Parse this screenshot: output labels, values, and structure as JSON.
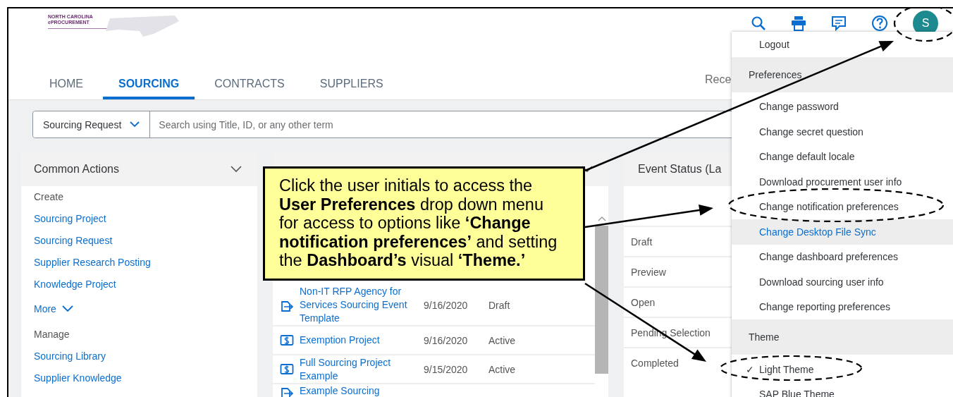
{
  "logo": {
    "lines": [
      "NORTH CAROLINA",
      "ePROCUREMENT"
    ]
  },
  "avatar": {
    "initials": "S"
  },
  "tabs": [
    {
      "label": "HOME",
      "selected": false
    },
    {
      "label": "SOURCING",
      "selected": true
    },
    {
      "label": "CONTRACTS",
      "selected": false
    },
    {
      "label": "SUPPLIERS",
      "selected": false
    }
  ],
  "tabs_right_text": "Rece",
  "search": {
    "scope": "Sourcing Request",
    "placeholder": "Search using Title, ID, or any other term"
  },
  "common_actions": {
    "title": "Common Actions",
    "items": [
      {
        "kind": "heading",
        "label": "Create"
      },
      {
        "kind": "link",
        "label": "Sourcing Project"
      },
      {
        "kind": "link",
        "label": "Sourcing Request"
      },
      {
        "kind": "link",
        "label": "Supplier Research Posting"
      },
      {
        "kind": "link",
        "label": "Knowledge Project"
      },
      {
        "kind": "more",
        "label": "More"
      },
      {
        "kind": "heading",
        "label": "Manage"
      },
      {
        "kind": "link",
        "label": "Sourcing Library"
      },
      {
        "kind": "link",
        "label": "Supplier Knowledge"
      }
    ]
  },
  "projects": {
    "rows": [
      {
        "kind": "rfp",
        "title": "Non-IT RFP Agency for Services Sourcing Event Template",
        "date": "9/16/2020",
        "status": "Draft"
      },
      {
        "kind": "dollar",
        "title": "Exemption Project",
        "date": "9/16/2020",
        "status": "Active"
      },
      {
        "kind": "dollar",
        "title": "Full Sourcing Project Example",
        "date": "9/15/2020",
        "status": "Active"
      },
      {
        "kind": "rfp",
        "title": "Example Sourcing"
      }
    ]
  },
  "event_status": {
    "title": "Event Status (La",
    "rows": [
      "Draft",
      "Preview",
      "Open",
      "Pending Selection",
      "Completed"
    ]
  },
  "user_menu": {
    "logout": "Logout",
    "sections": [
      {
        "title": "Preferences",
        "items": [
          {
            "label": "Change password",
            "highlighted": false
          },
          {
            "label": "Change secret question",
            "highlighted": false
          },
          {
            "label": "Change default locale",
            "highlighted": false
          },
          {
            "label": "Download procurement user info",
            "highlighted": false
          },
          {
            "label": "Change notification preferences",
            "highlighted": false
          },
          {
            "label": "Change Desktop File Sync",
            "highlighted": true
          },
          {
            "label": "Change dashboard preferences",
            "highlighted": false
          },
          {
            "label": "Download sourcing user info",
            "highlighted": false
          },
          {
            "label": "Change reporting preferences",
            "highlighted": false
          }
        ]
      },
      {
        "title": "Theme",
        "check_mark": "✓",
        "items": [
          {
            "label": "Light Theme",
            "checked": true,
            "highlighted": false
          },
          {
            "label": "SAP Blue Theme",
            "checked": false,
            "highlighted": false
          }
        ]
      }
    ]
  },
  "callout": {
    "text": "Click the user initials to access the **User Preferences** drop down menu for access to options like **‘Change notification preferences’** and setting the **Dashboard’s** visual **‘Theme.’**"
  }
}
